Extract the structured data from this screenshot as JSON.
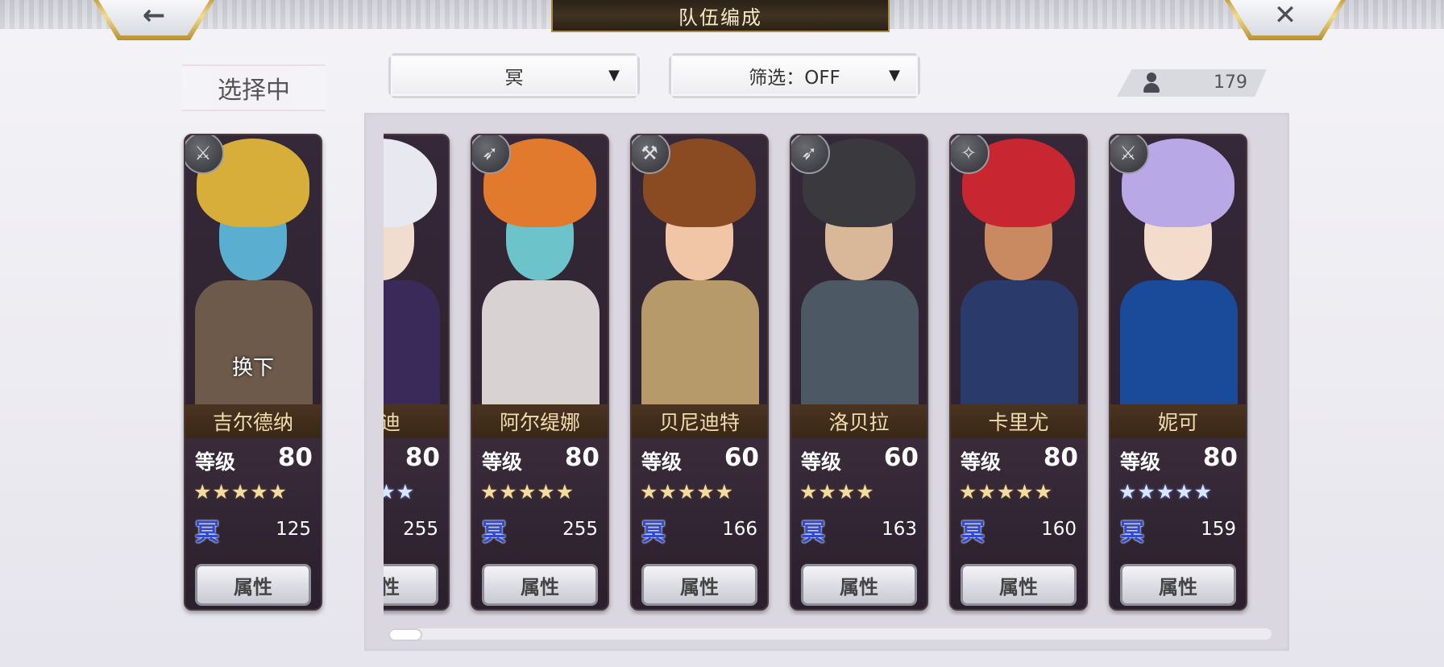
{
  "header": {
    "title": "队伍编成",
    "back_icon": "←",
    "close_icon": "✕"
  },
  "selecting_label": "选择中",
  "filters": {
    "element_value": "冥",
    "filter_value": "筛选：OFF",
    "caret": "▼"
  },
  "roster_count": "179",
  "common": {
    "level_label": "等级",
    "attr_button": "属性",
    "element_badge": "冥"
  },
  "selected": {
    "name": "吉尔德纳",
    "level": "80",
    "stars": "★★★★★",
    "power": "125",
    "swap_label": "换下",
    "class_icon": "sword-icon",
    "colors": {
      "hair": "#d8ae3a",
      "skin": "#5aaed0",
      "outfit": "#6d5a4a"
    }
  },
  "characters": [
    {
      "name": "尔迪",
      "level": "80",
      "stars": "★★★★★",
      "star_color": "blue",
      "power": "255",
      "class_icon": "bow-icon",
      "colors": {
        "hair": "#e8e8f0",
        "skin": "#f1dcd0",
        "outfit": "#3a2a5a"
      }
    },
    {
      "name": "阿尔缇娜",
      "level": "80",
      "stars": "★★★★★",
      "star_color": "gold",
      "power": "255",
      "class_icon": "bow-icon",
      "colors": {
        "hair": "#e27a2e",
        "skin": "#6cc3c9",
        "outfit": "#d8d2d2"
      }
    },
    {
      "name": "贝尼迪特",
      "level": "60",
      "stars": "★★★★★",
      "star_color": "gold",
      "power": "166",
      "class_icon": "axe-icon",
      "colors": {
        "hair": "#8a4a22",
        "skin": "#f1c6a6",
        "outfit": "#b79a6a"
      }
    },
    {
      "name": "洛贝拉",
      "level": "60",
      "stars": "★★★★",
      "star_color": "gold",
      "power": "163",
      "class_icon": "bow-icon",
      "colors": {
        "hair": "#3a3a3e",
        "skin": "#d9b89a",
        "outfit": "#4c5864"
      }
    },
    {
      "name": "卡里尤",
      "level": "80",
      "stars": "★★★★★",
      "star_color": "gold",
      "power": "160",
      "class_icon": "staff-icon",
      "colors": {
        "hair": "#c82630",
        "skin": "#c98a62",
        "outfit": "#2a3a6a"
      }
    },
    {
      "name": "妮可",
      "level": "80",
      "stars": "★★★★★",
      "star_color": "blue",
      "power": "159",
      "class_icon": "sword-icon",
      "colors": {
        "hair": "#b8a8e6",
        "skin": "#f4dccc",
        "outfit": "#1a4a9a"
      }
    }
  ]
}
